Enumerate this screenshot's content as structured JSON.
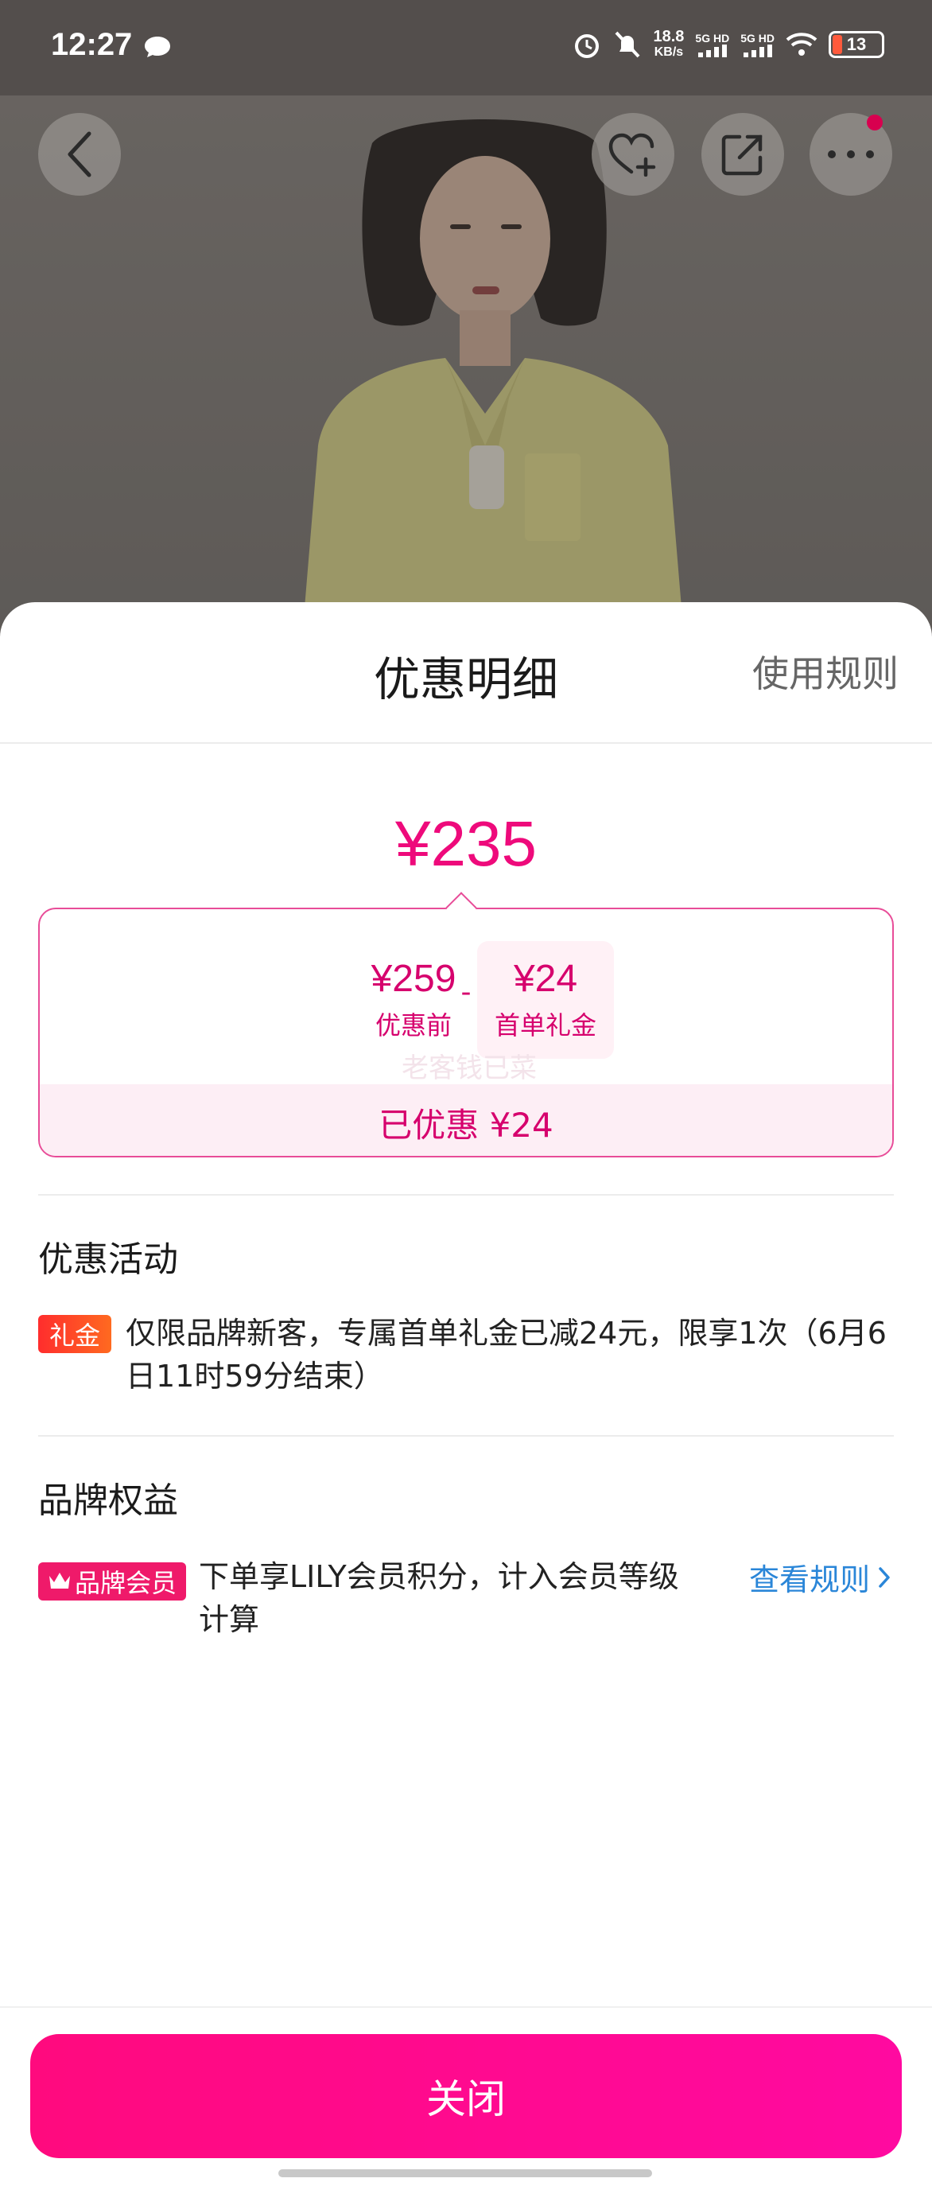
{
  "status_bar": {
    "time": "12:27",
    "net_speed_value": "18.8",
    "net_speed_unit": "KB/s",
    "sim1": "5G HD",
    "sim2": "5G HD",
    "battery": "13"
  },
  "nav": {
    "back_icon": "chevron-left-icon",
    "favorite_icon": "heart-plus-icon",
    "share_icon": "share-icon",
    "more_icon": "more-icon"
  },
  "sheet": {
    "title": "优惠明细",
    "rules_link": "使用规则",
    "final_price": "¥235",
    "original_price": "¥259",
    "original_label": "优惠前",
    "minus_sign": "-",
    "gift_amount": "¥24",
    "gift_label": "首单礼金",
    "ghost_text": "老客钱已菜",
    "saved_text": "已优惠 ¥24"
  },
  "promo_section": {
    "title": "优惠活动",
    "badge": "礼金",
    "line1": "仅限品牌新客，专属首单礼金已减24元，限享1次（6月6",
    "line2": "日11时59分结束）"
  },
  "brand_section": {
    "title": "品牌权益",
    "badge": "品牌会员",
    "line1": "下单享LILY会员积分，计入会员等级",
    "line2": "计算",
    "view_rules": "查看规则"
  },
  "footer": {
    "close_label": "关闭"
  },
  "colors": {
    "accent": "#ee0a7b",
    "link": "#2a86d8"
  }
}
